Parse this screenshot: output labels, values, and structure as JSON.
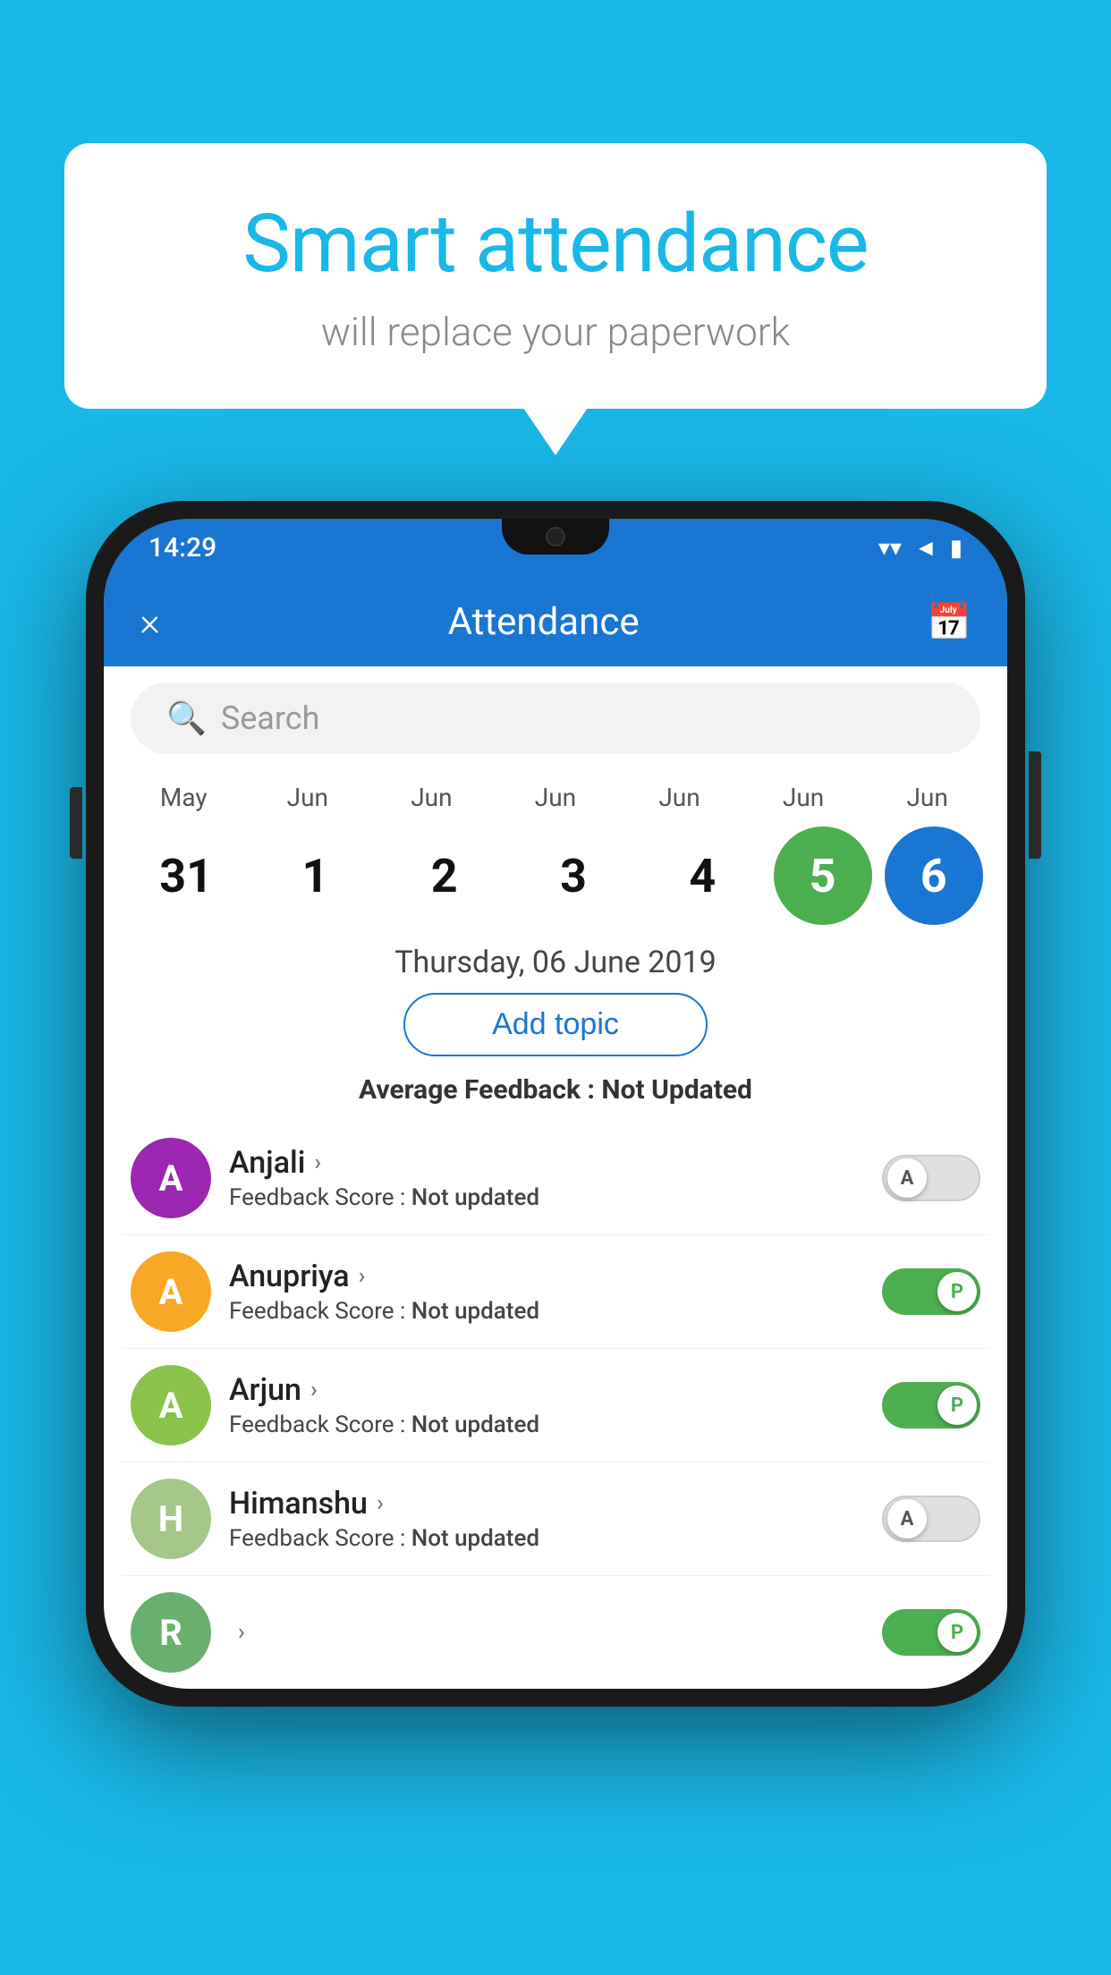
{
  "background": {
    "color": "#1ab8e8"
  },
  "speech_bubble": {
    "title": "Smart attendance",
    "subtitle": "will replace your paperwork"
  },
  "status_bar": {
    "time": "14:29",
    "wifi": "wifi",
    "signal": "signal",
    "battery": "battery"
  },
  "header": {
    "title": "Attendance",
    "close_label": "×",
    "calendar_label": "📅"
  },
  "search": {
    "placeholder": "Search"
  },
  "date_picker": {
    "months": [
      "May",
      "Jun",
      "Jun",
      "Jun",
      "Jun",
      "Jun",
      "Jun"
    ],
    "days": [
      "31",
      "1",
      "2",
      "3",
      "4",
      "5",
      "6"
    ],
    "selected_day5": "5",
    "selected_day6": "6",
    "selected_date_label": "Thursday, 06 June 2019"
  },
  "add_topic": {
    "label": "Add topic"
  },
  "avg_feedback": {
    "label": "Average Feedback : ",
    "value": "Not Updated"
  },
  "students": [
    {
      "name": "Anjali",
      "avatar_letter": "A",
      "avatar_color": "#9c27b0",
      "feedback_label": "Feedback Score : ",
      "feedback_value": "Not updated",
      "toggle_state": "off",
      "toggle_letter": "A"
    },
    {
      "name": "Anupriya",
      "avatar_letter": "A",
      "avatar_color": "#f9a825",
      "feedback_label": "Feedback Score : ",
      "feedback_value": "Not updated",
      "toggle_state": "on",
      "toggle_letter": "P"
    },
    {
      "name": "Arjun",
      "avatar_letter": "A",
      "avatar_color": "#8bc34a",
      "feedback_label": "Feedback Score : ",
      "feedback_value": "Not updated",
      "toggle_state": "on",
      "toggle_letter": "P"
    },
    {
      "name": "Himanshu",
      "avatar_letter": "H",
      "avatar_color": "#a5c789",
      "feedback_label": "Feedback Score : ",
      "feedback_value": "Not updated",
      "toggle_state": "off",
      "toggle_letter": "A"
    }
  ]
}
